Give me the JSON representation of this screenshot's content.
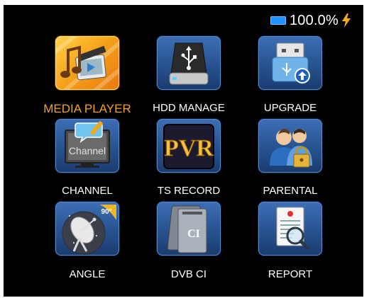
{
  "status": {
    "battery_percent": "100.0%",
    "battery_color": "#1e90ff",
    "charging_icon": "lightning-bolt-icon",
    "charging_color": "#f7a81b"
  },
  "menu": {
    "selected_index": 0,
    "selected_label_color": "#f6a02c",
    "items": [
      {
        "label": "MEDIA PLAYER",
        "icon": "media-player-icon"
      },
      {
        "label": "HDD MANAGE",
        "icon": "usb-drive-icon"
      },
      {
        "label": "UPGRADE",
        "icon": "usb-upgrade-icon"
      },
      {
        "label": "CHANNEL",
        "icon": "channel-tv-icon"
      },
      {
        "label": "TS RECORD",
        "icon": "pvr-icon"
      },
      {
        "label": "PARENTAL",
        "icon": "parental-lock-icon"
      },
      {
        "label": "ANGLE",
        "icon": "satellite-dish-icon"
      },
      {
        "label": "DVB CI",
        "icon": "ci-card-icon"
      },
      {
        "label": "REPORT",
        "icon": "report-magnifier-icon"
      }
    ],
    "channel_icon_text": "Channel",
    "pvr_icon_text": "PVR",
    "angle_icon_text": "90°",
    "ci_icon_text": "CI"
  }
}
